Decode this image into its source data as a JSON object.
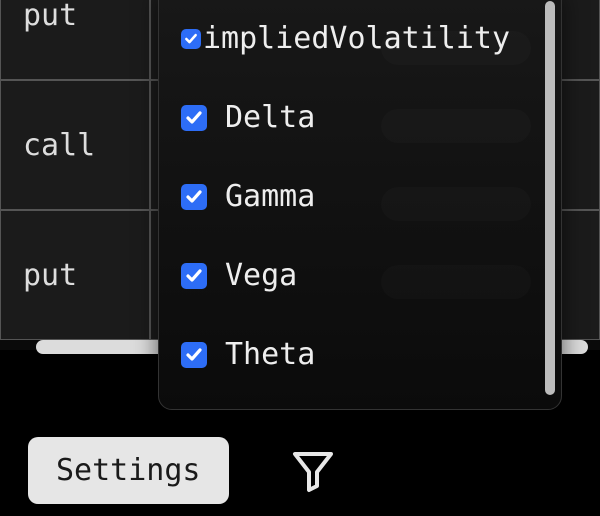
{
  "table": {
    "rows": [
      {
        "type": "put"
      },
      {
        "type": "call"
      },
      {
        "type": "put"
      }
    ]
  },
  "popup": {
    "options": [
      {
        "label": "impliedVolatility",
        "checked": true
      },
      {
        "label": "Delta",
        "checked": true
      },
      {
        "label": "Gamma",
        "checked": true
      },
      {
        "label": "Vega",
        "checked": true
      },
      {
        "label": "Theta",
        "checked": true
      }
    ]
  },
  "toolbar": {
    "settings_label": "Settings"
  }
}
